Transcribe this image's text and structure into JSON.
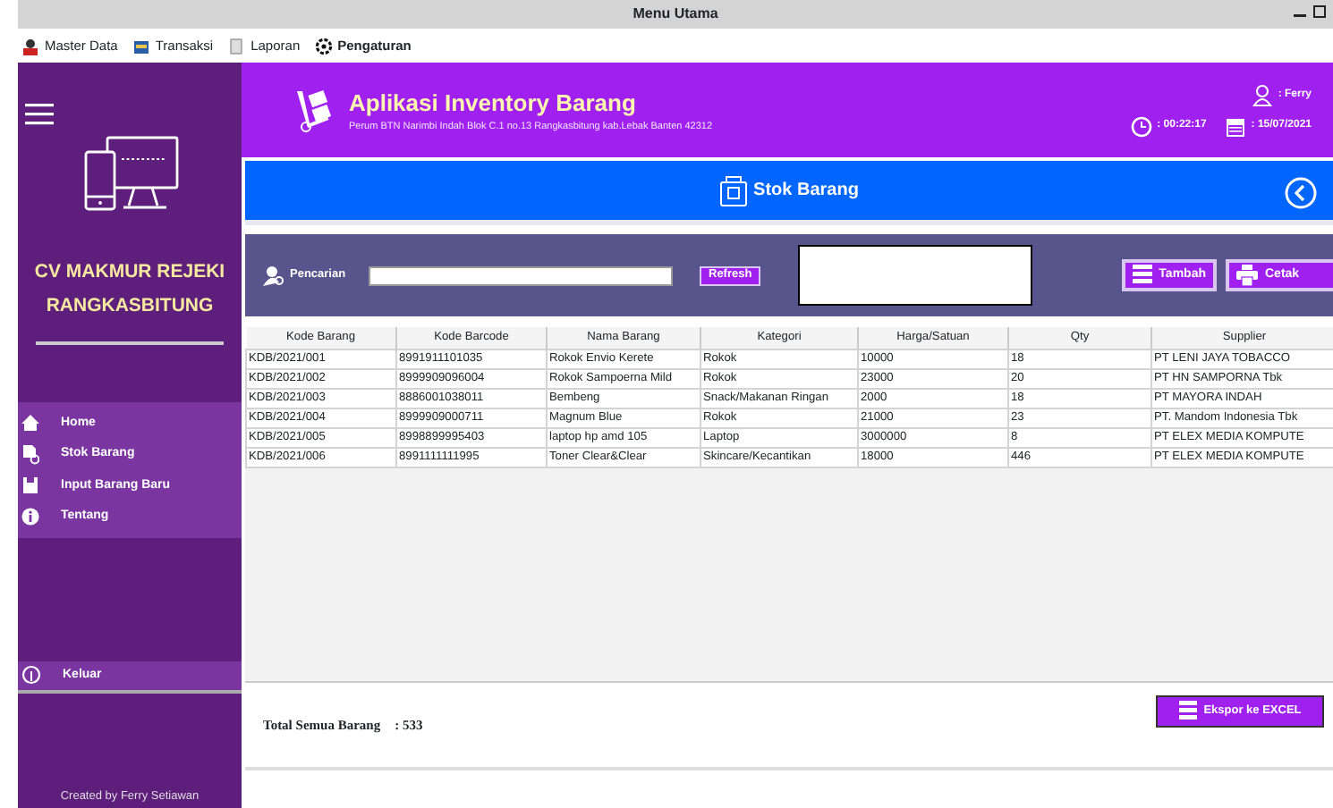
{
  "window": {
    "title": "Menu Utama"
  },
  "menu_bar": [
    {
      "label": "Master Data"
    },
    {
      "label": "Transaksi"
    },
    {
      "label": "Laporan"
    },
    {
      "label": "Pengaturan"
    }
  ],
  "header": {
    "title": "Aplikasi Inventory Barang",
    "address": "Perum BTN Narimbi Indah Blok C.1 no.13 Rangkasbitung kab.Lebak Banten 42312",
    "user": ": Ferry",
    "time": ": 00:22:17",
    "date": ": 15/07/2021"
  },
  "sidebar": {
    "company": "CV MAKMUR REJEKI RANGKASBITUNG",
    "items": [
      {
        "label": "Home"
      },
      {
        "label": "Stok Barang"
      },
      {
        "label": "Input Barang Baru"
      },
      {
        "label": "Tentang"
      }
    ],
    "logout": "Keluar",
    "credit": "Created by Ferry Setiawan"
  },
  "page": {
    "title": "Stok Barang",
    "search_label": "Pencarian",
    "refresh": "Refresh",
    "add": "Tambah",
    "print": "Cetak"
  },
  "table": {
    "columns": [
      "Kode Barang",
      "Kode Barcode",
      "Nama Barang",
      "Kategori",
      "Harga/Satuan",
      "Qty",
      "Supplier"
    ],
    "rows": [
      [
        "KDB/2021/001",
        "8991911101035",
        "Rokok Envio Kerete",
        "Rokok",
        "10000",
        "18",
        "PT  LENI JAYA TOBACCO"
      ],
      [
        "KDB/2021/002",
        "8999909096004",
        "Rokok Sampoerna Mild",
        "Rokok",
        "23000",
        "20",
        "PT HN SAMPORNA Tbk"
      ],
      [
        "KDB/2021/003",
        "8886001038011",
        "Bembeng",
        "Snack/Makanan Ringan",
        "2000",
        "18",
        "PT MAYORA INDAH"
      ],
      [
        "KDB/2021/004",
        "8999909000711",
        "Magnum Blue",
        "Rokok",
        "21000",
        "23",
        "PT. Mandom Indonesia Tbk"
      ],
      [
        "KDB/2021/005",
        "8998899995403",
        "laptop hp amd 105",
        "Laptop",
        "3000000",
        "8",
        "PT ELEX MEDIA KOMPUTE"
      ],
      [
        "KDB/2021/006",
        "8991111111995",
        "Toner Clear&Clear",
        "Skincare/Kecantikan",
        "18000",
        "446",
        "PT ELEX MEDIA KOMPUTE"
      ]
    ]
  },
  "footer": {
    "total_label": "Total Semua Barang",
    "total_value": ":  533",
    "export": "Ekspor ke EXCEL"
  }
}
